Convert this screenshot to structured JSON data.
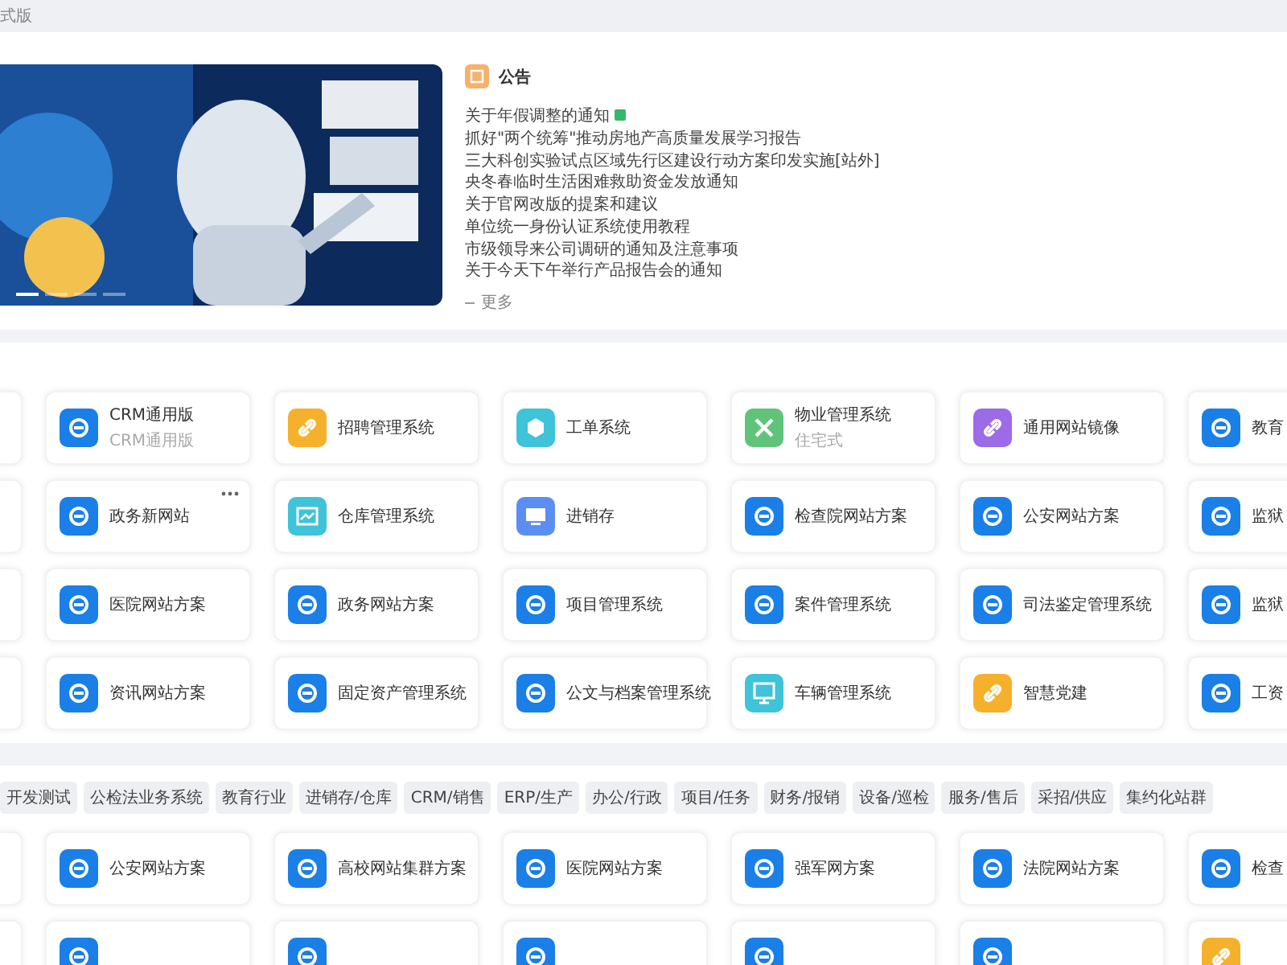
{
  "header": {
    "title": "式版"
  },
  "banner": {
    "kind": "picture",
    "slides": [
      {
        "selected": true
      },
      {
        "selected": false
      },
      {
        "selected": false
      },
      {
        "selected": false
      }
    ]
  },
  "notice": {
    "title": "公告",
    "items": [
      {
        "text": "关于年假调整的通知",
        "new": true
      },
      {
        "text": "抓好\"两个统筹\"推动房地产高质量发展学习报告",
        "new": false
      },
      {
        "text": "三大科创实验试点区域先行区建设行动方案印发实施[站外]",
        "new": false
      },
      {
        "text": "央冬春临时生活困难救助资金发放通知",
        "new": false
      },
      {
        "text": "关于官网改版的提案和建议",
        "new": false
      },
      {
        "text": "单位统一身份认证系统使用教程",
        "new": false
      },
      {
        "text": "市级领导来公司调研的通知及注意事项",
        "new": false
      },
      {
        "text": "关于今天下午举行产品报告会的通知",
        "new": false
      }
    ],
    "more": "更多"
  },
  "apps": [
    [
      {
        "kind": "blank"
      },
      {
        "kind": "e",
        "color": "#1a7fe6",
        "label": "CRM通用版",
        "sub": "CRM通用版"
      },
      {
        "kind": "link",
        "color": "#f5b12b",
        "label": "招聘管理系统"
      },
      {
        "kind": "tag",
        "color": "#3ec3d8",
        "label": "工单系统"
      },
      {
        "kind": "tools",
        "color": "#5fc47a",
        "label": "物业管理系统",
        "sub": "住宅式"
      },
      {
        "kind": "link",
        "color": "#9b6be8",
        "label": "通用网站镜像"
      },
      {
        "kind": "e",
        "color": "#1a7fe6",
        "label": "教育"
      }
    ],
    [
      {
        "kind": "blank"
      },
      {
        "kind": "e",
        "color": "#1a7fe6",
        "label": "政务新网站",
        "menu": true
      },
      {
        "kind": "chart",
        "color": "#3ec3d8",
        "label": "仓库管理系统"
      },
      {
        "kind": "screen",
        "color": "#5b8ef0",
        "label": "进销存"
      },
      {
        "kind": "e",
        "color": "#1a7fe6",
        "label": "检查院网站方案"
      },
      {
        "kind": "e",
        "color": "#1a7fe6",
        "label": "公安网站方案"
      },
      {
        "kind": "e",
        "color": "#1a7fe6",
        "label": "监狱"
      }
    ],
    [
      {
        "kind": "blank"
      },
      {
        "kind": "e",
        "color": "#1a7fe6",
        "label": "医院网站方案"
      },
      {
        "kind": "e",
        "color": "#1a7fe6",
        "label": "政务网站方案"
      },
      {
        "kind": "e",
        "color": "#1a7fe6",
        "label": "项目管理系统"
      },
      {
        "kind": "e",
        "color": "#1a7fe6",
        "label": "案件管理系统"
      },
      {
        "kind": "e",
        "color": "#1a7fe6",
        "label": "司法鉴定管理系统"
      },
      {
        "kind": "e",
        "color": "#1a7fe6",
        "label": "监狱"
      }
    ],
    [
      {
        "kind": "blank"
      },
      {
        "kind": "e",
        "color": "#1a7fe6",
        "label": "资讯网站方案"
      },
      {
        "kind": "e",
        "color": "#1a7fe6",
        "label": "固定资产管理系统"
      },
      {
        "kind": "e",
        "color": "#1a7fe6",
        "label": "公文与档案管理系统"
      },
      {
        "kind": "monitor",
        "color": "#3ec3d8",
        "label": "车辆管理系统"
      },
      {
        "kind": "link",
        "color": "#f5b12b",
        "label": "智慧党建"
      },
      {
        "kind": "e",
        "color": "#1a7fe6",
        "label": "工资"
      }
    ]
  ],
  "categories": [
    "开发测试",
    "公检法业务系统",
    "教育行业",
    "进销存/仓库",
    "CRM/销售",
    "ERP/生产",
    "办公/行政",
    "项目/任务",
    "财务/报销",
    "设备/巡检",
    "服务/售后",
    "采招/供应",
    "集约化站群"
  ],
  "solutions": [
    [
      {
        "kind": "blank"
      },
      {
        "kind": "e",
        "color": "#1a7fe6",
        "label": "公安网站方案"
      },
      {
        "kind": "e",
        "color": "#1a7fe6",
        "label": "高校网站集群方案"
      },
      {
        "kind": "e",
        "color": "#1a7fe6",
        "label": "医院网站方案"
      },
      {
        "kind": "e",
        "color": "#1a7fe6",
        "label": "强军网方案"
      },
      {
        "kind": "e",
        "color": "#1a7fe6",
        "label": "法院网站方案"
      },
      {
        "kind": "e",
        "color": "#1a7fe6",
        "label": "检查"
      }
    ],
    [
      {
        "kind": "blank"
      },
      {
        "kind": "e",
        "color": "#1a7fe6"
      },
      {
        "kind": "e",
        "color": "#1a7fe6"
      },
      {
        "kind": "e",
        "color": "#1a7fe6"
      },
      {
        "kind": "e",
        "color": "#1a7fe6"
      },
      {
        "kind": "e",
        "color": "#1a7fe6"
      },
      {
        "kind": "link",
        "color": "#f5b12b"
      }
    ]
  ]
}
